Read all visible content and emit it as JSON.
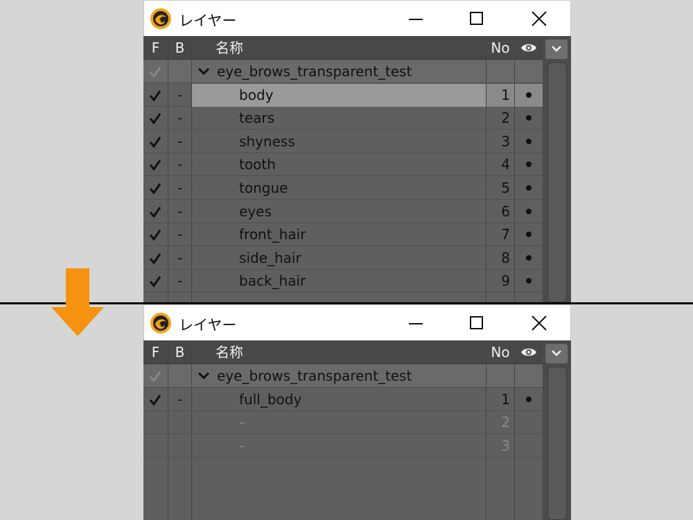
{
  "colors": {
    "arrow": "#f5920f",
    "panel_bg": "#5f5f5f",
    "header_bg": "#484848",
    "selected_row": "#9a9a9a",
    "titlebar_bg": "#ffffff"
  },
  "window": {
    "title": "レイヤー",
    "app_icon": "dragon-logo-icon",
    "min_icon": "minimize-icon",
    "max_icon": "maximize-icon",
    "close_icon": "close-icon"
  },
  "columns": {
    "f": "F",
    "b": "B",
    "name": "名称",
    "no": "No",
    "eye_icon": "eye-icon"
  },
  "top_panel": {
    "group": {
      "name": "eye_brows_transparent_test",
      "expanded": true
    },
    "rows": [
      {
        "name": "body",
        "b": "-",
        "no": "1",
        "selected": true
      },
      {
        "name": "tears",
        "b": "-",
        "no": "2"
      },
      {
        "name": "shyness",
        "b": "-",
        "no": "3"
      },
      {
        "name": "tooth",
        "b": "-",
        "no": "4"
      },
      {
        "name": "tongue",
        "b": "-",
        "no": "5"
      },
      {
        "name": "eyes",
        "b": "-",
        "no": "6"
      },
      {
        "name": "front_hair",
        "b": "-",
        "no": "7"
      },
      {
        "name": "side_hair",
        "b": "-",
        "no": "8"
      },
      {
        "name": "back_hair",
        "b": "-",
        "no": "9"
      }
    ]
  },
  "bottom_panel": {
    "group": {
      "name": "eye_brows_transparent_test",
      "expanded": true
    },
    "rows": [
      {
        "name": "full_body",
        "b": "-",
        "no": "1"
      },
      {
        "name": "-",
        "b": "",
        "no": "2",
        "empty": true
      },
      {
        "name": "-",
        "b": "",
        "no": "3",
        "empty": true
      }
    ]
  }
}
